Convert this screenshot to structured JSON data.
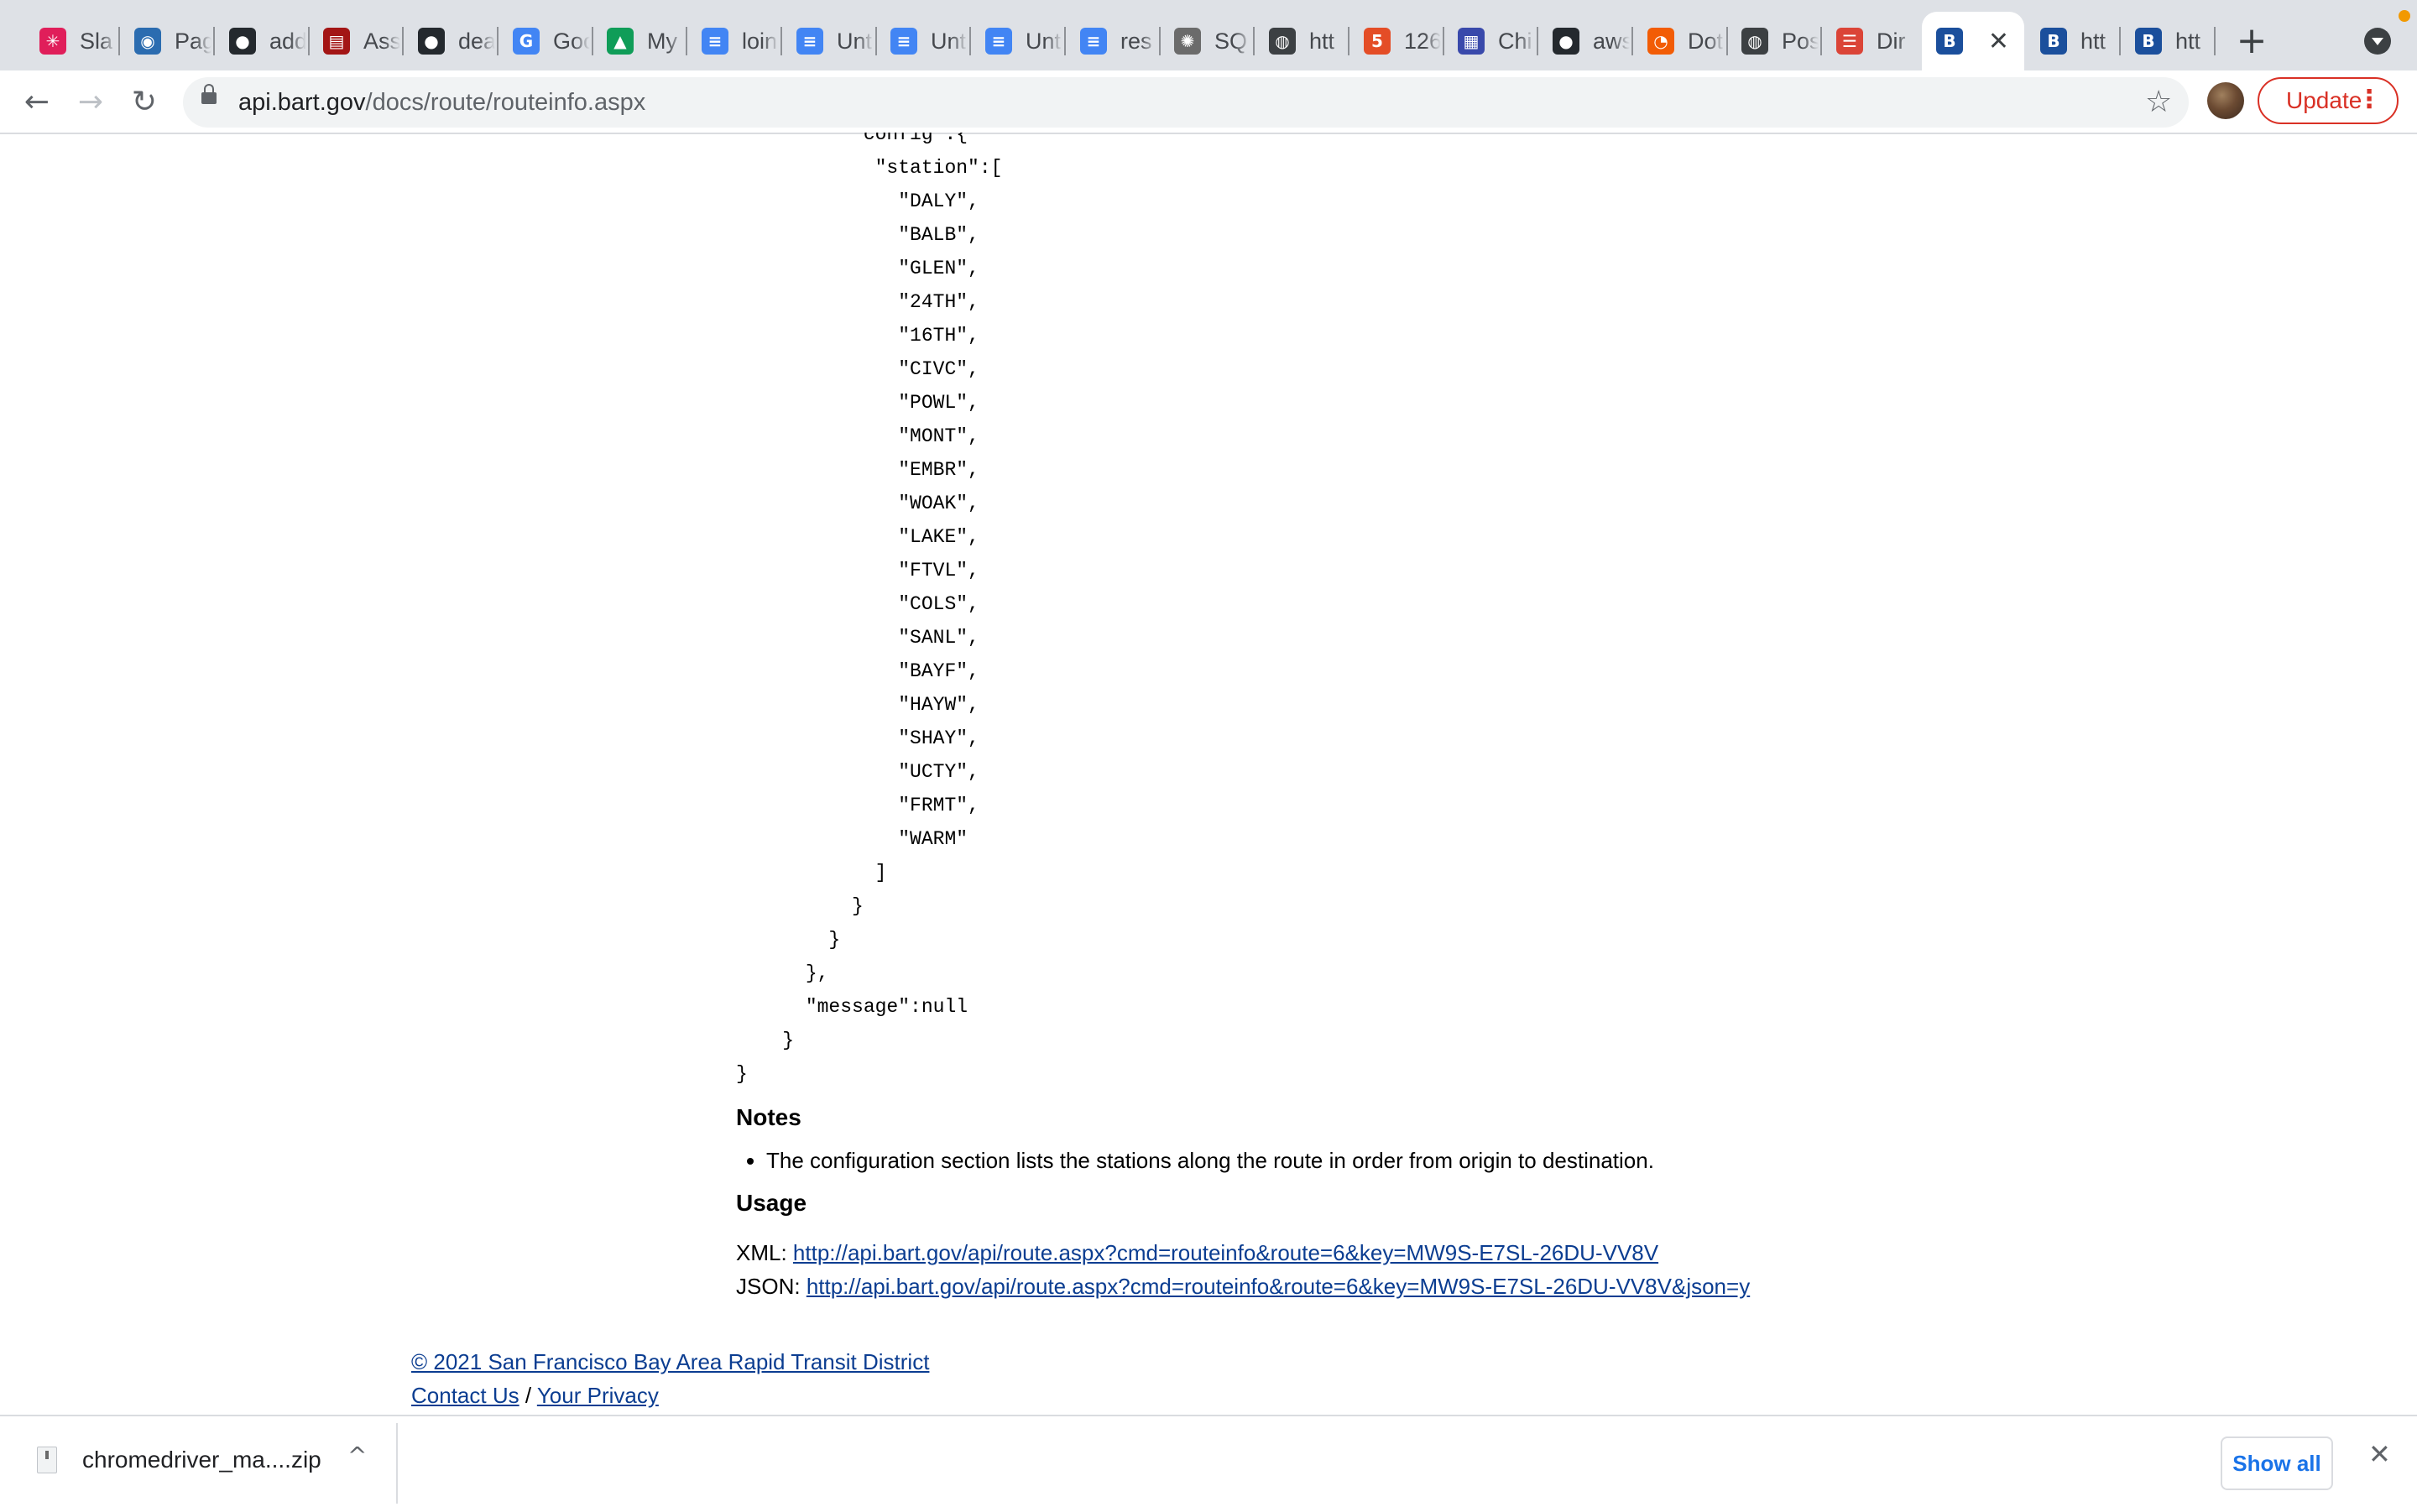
{
  "browser": {
    "tabs": [
      {
        "label": "Sla",
        "icon": "slack-icon",
        "color": "#e01e5a",
        "glyph": "✳"
      },
      {
        "label": "Pag",
        "icon": "eye-icon",
        "color": "#2b6cb0",
        "glyph": "◉"
      },
      {
        "label": "add",
        "icon": "github-icon",
        "color": "#24292e",
        "glyph": "●"
      },
      {
        "label": "Ass",
        "icon": "book-icon",
        "color": "#a31515",
        "glyph": "▤"
      },
      {
        "label": "dea",
        "icon": "github-icon",
        "color": "#24292e",
        "glyph": "●"
      },
      {
        "label": "Goo",
        "icon": "google-icon",
        "color": "#4285f4",
        "glyph": "G"
      },
      {
        "label": "My ",
        "icon": "google-drive-icon",
        "color": "#0f9d58",
        "glyph": "▲"
      },
      {
        "label": "loin",
        "icon": "google-docs-icon",
        "color": "#4285f4",
        "glyph": "≡"
      },
      {
        "label": "Unt",
        "icon": "google-docs-icon",
        "color": "#4285f4",
        "glyph": "≡"
      },
      {
        "label": "Unt",
        "icon": "google-docs-icon",
        "color": "#4285f4",
        "glyph": "≡"
      },
      {
        "label": "Unt",
        "icon": "google-docs-icon",
        "color": "#4285f4",
        "glyph": "≡"
      },
      {
        "label": "res",
        "icon": "google-docs-icon",
        "color": "#4285f4",
        "glyph": "≡"
      },
      {
        "label": "SQ",
        "icon": "gear-icon",
        "color": "#6b6b6b",
        "glyph": "✺"
      },
      {
        "label": "htt",
        "icon": "globe-icon",
        "color": "#3c4043",
        "glyph": "◍"
      },
      {
        "label": "126",
        "icon": "html5-icon",
        "color": "#e44d26",
        "glyph": "5"
      },
      {
        "label": "Chi",
        "icon": "layout-icon",
        "color": "#3949ab",
        "glyph": "▦"
      },
      {
        "label": "aws",
        "icon": "github-icon",
        "color": "#24292e",
        "glyph": "●"
      },
      {
        "label": "Dot",
        "icon": "clock-icon",
        "color": "#f25c05",
        "glyph": "◔"
      },
      {
        "label": "Pos",
        "icon": "globe-icon",
        "color": "#3c4043",
        "glyph": "◍"
      },
      {
        "label": "Dir",
        "icon": "bars-icon",
        "color": "#db4437",
        "glyph": "☰"
      },
      {
        "label": "",
        "icon": "bart-icon",
        "color": "#1b4f9c",
        "glyph": "B",
        "active": true
      },
      {
        "label": "htt",
        "icon": "bart-icon",
        "color": "#1b4f9c",
        "glyph": "B"
      },
      {
        "label": "htt",
        "icon": "bart-icon",
        "color": "#1b4f9c",
        "glyph": "B"
      }
    ],
    "close_glyph": "✕",
    "new_tab_glyph": "+",
    "url_host": "api.bart.gov",
    "url_path": "/docs/route/routeinfo.aspx",
    "back_glyph": "←",
    "forward_glyph": "→",
    "reload_glyph": "↻",
    "star_glyph": "☆",
    "update_label": "Update",
    "menu_glyph": "⋮",
    "accent_update": "#d93025"
  },
  "page": {
    "code_lines": [
      "          \"config\":{",
      "            \"station\":[",
      "              \"DALY\",",
      "              \"BALB\",",
      "              \"GLEN\",",
      "              \"24TH\",",
      "              \"16TH\",",
      "              \"CIVC\",",
      "              \"POWL\",",
      "              \"MONT\",",
      "              \"EMBR\",",
      "              \"WOAK\",",
      "              \"LAKE\",",
      "              \"FTVL\",",
      "              \"COLS\",",
      "              \"SANL\",",
      "              \"BAYF\",",
      "              \"HAYW\",",
      "              \"SHAY\",",
      "              \"UCTY\",",
      "              \"FRMT\",",
      "              \"WARM\"",
      "            ]",
      "          }",
      "        }",
      "      },",
      "      \"message\":null",
      "    }",
      "}"
    ],
    "notes_heading": "Notes",
    "notes": [
      "The configuration section lists the stations along the route in order from origin to destination."
    ],
    "usage_heading": "Usage",
    "usage": {
      "xml_label": "XML:",
      "xml_url": "http://api.bart.gov/api/route.aspx?cmd=routeinfo&route=6&key=MW9S-E7SL-26DU-VV8V",
      "json_label": "JSON:",
      "json_url": "http://api.bart.gov/api/route.aspx?cmd=routeinfo&route=6&key=MW9S-E7SL-26DU-VV8V&json=y"
    },
    "footer": {
      "copyright": "© 2021 San Francisco Bay Area Rapid Transit District",
      "contact": "Contact Us",
      "separator": "/",
      "privacy": "Your Privacy"
    },
    "link_color": "#0b3d91"
  },
  "download_shelf": {
    "filename": "chromedriver_ma....zip",
    "chevron_glyph": "^",
    "show_all": "Show all",
    "close_glyph": "✕"
  }
}
